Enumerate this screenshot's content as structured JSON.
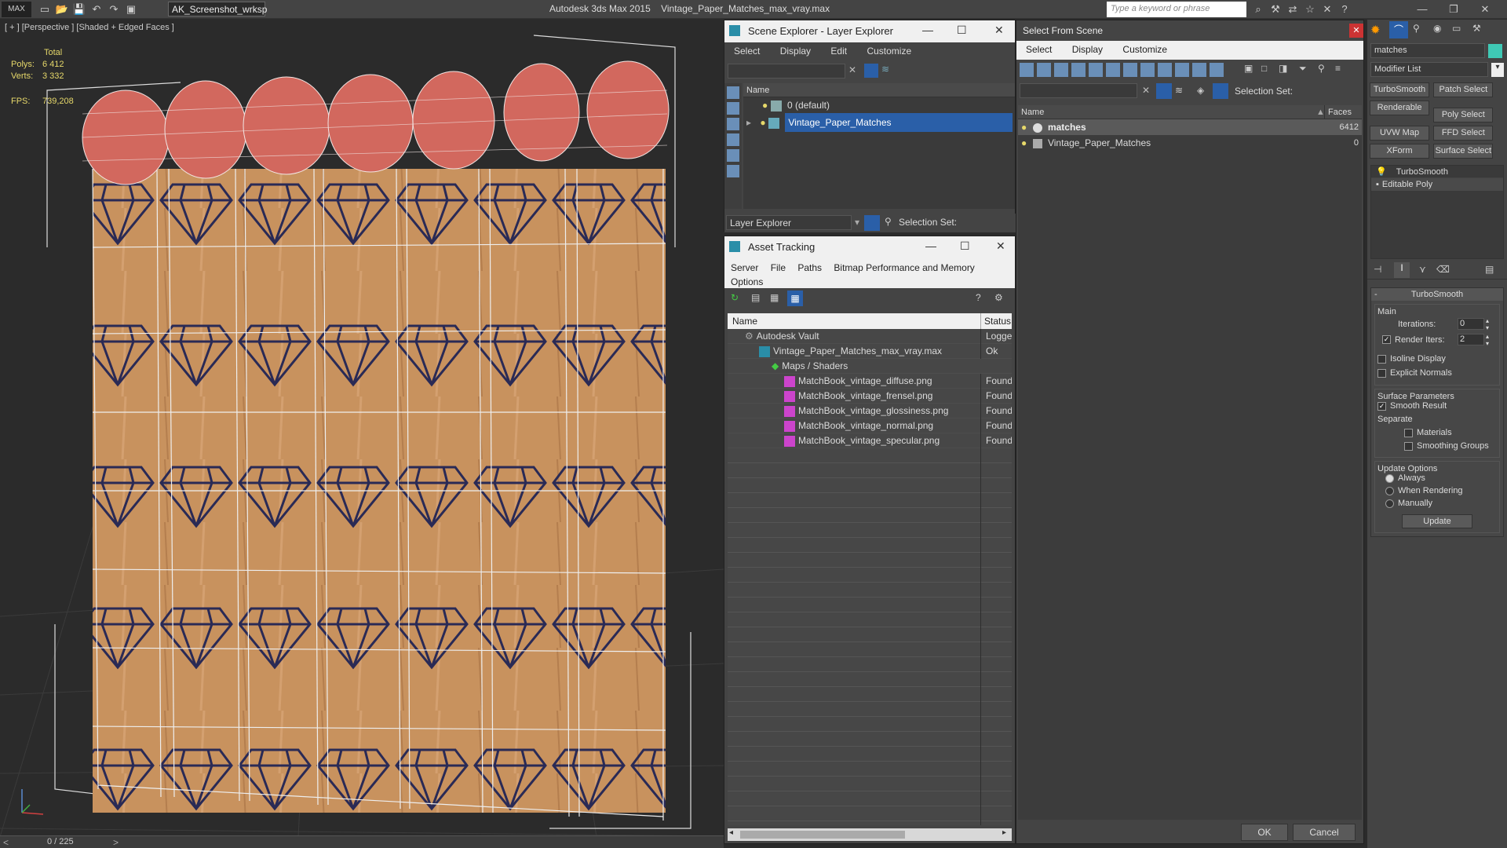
{
  "titlebar": {
    "workspace": "AK_Screenshot_wrksp",
    "app_name": "Autodesk 3ds Max  2015",
    "file_name": "Vintage_Paper_Matches_max_vray.max",
    "search_placeholder": "Type a keyword or phrase"
  },
  "viewport": {
    "label": "[ + ] [Perspective ] [Shaded + Edged Faces ]",
    "stats": {
      "total_label": "Total",
      "polys_label": "Polys:",
      "polys_value": "6 412",
      "verts_label": "Verts:",
      "verts_value": "3 332",
      "fps_label": "FPS:",
      "fps_value": "739,208"
    }
  },
  "statusbar": {
    "frame_counter": "0 / 225"
  },
  "layer_explorer": {
    "title": "Scene Explorer - Layer Explorer",
    "menu": [
      "Select",
      "Display",
      "Edit",
      "Customize"
    ],
    "column_name": "Name",
    "rows": [
      {
        "label": "0 (default)",
        "selected": false
      },
      {
        "label": "Vintage_Paper_Matches",
        "selected": true
      }
    ],
    "footer_dropdown": "Layer Explorer",
    "selection_set_label": "Selection Set:"
  },
  "asset_tracking": {
    "title": "Asset Tracking",
    "menu": [
      "Server",
      "File",
      "Paths",
      "Bitmap Performance and Memory",
      "Options"
    ],
    "col_name": "Name",
    "col_status": "Status",
    "rows": [
      {
        "name": "Autodesk Vault",
        "status": "Logged"
      },
      {
        "name": "Vintage_Paper_Matches_max_vray.max",
        "status": "Ok"
      },
      {
        "name": "Maps / Shaders",
        "status": ""
      },
      {
        "name": "MatchBook_vintage_diffuse.png",
        "status": "Found"
      },
      {
        "name": "MatchBook_vintage_frensel.png",
        "status": "Found"
      },
      {
        "name": "MatchBook_vintage_glossiness.png",
        "status": "Found"
      },
      {
        "name": "MatchBook_vintage_normal.png",
        "status": "Found"
      },
      {
        "name": "MatchBook_vintage_specular.png",
        "status": "Found"
      }
    ]
  },
  "select_from_scene": {
    "title": "Select From Scene",
    "menu": [
      "Select",
      "Display",
      "Customize"
    ],
    "selection_set_label": "Selection Set:",
    "col_name": "Name",
    "col_faces": "Faces",
    "rows": [
      {
        "name": "matches",
        "faces": "6412"
      },
      {
        "name": "Vintage_Paper_Matches",
        "faces": "0"
      }
    ],
    "ok_label": "OK",
    "cancel_label": "Cancel"
  },
  "command_panel": {
    "object_name": "matches",
    "modifier_list": "Modifier List",
    "buttons": [
      "TurboSmooth",
      "Patch Select",
      "Renderable Spline",
      "Poly Select",
      "UVW Map",
      "FFD Select",
      "XForm",
      "Surface Select"
    ],
    "stack": [
      "TurboSmooth",
      "Editable Poly"
    ],
    "rollout_title": "TurboSmooth",
    "main_label": "Main",
    "iterations_label": "Iterations:",
    "iterations_value": "0",
    "render_iters_label": "Render Iters:",
    "render_iters_value": "2",
    "isoline_label": "Isoline Display",
    "explicit_normals_label": "Explicit Normals",
    "surface_params_label": "Surface Parameters",
    "smooth_result_label": "Smooth Result",
    "separate_label": "Separate",
    "materials_label": "Materials",
    "smoothing_groups_label": "Smoothing Groups",
    "update_options_label": "Update Options",
    "always_label": "Always",
    "when_rendering_label": "When Rendering",
    "manually_label": "Manually",
    "update_button": "Update"
  },
  "colors": {
    "match_head": "#d2685e",
    "match_stick": "#c8925e",
    "diamond_ink": "#2a2a55",
    "selection_blue": "#2a5fa8"
  }
}
